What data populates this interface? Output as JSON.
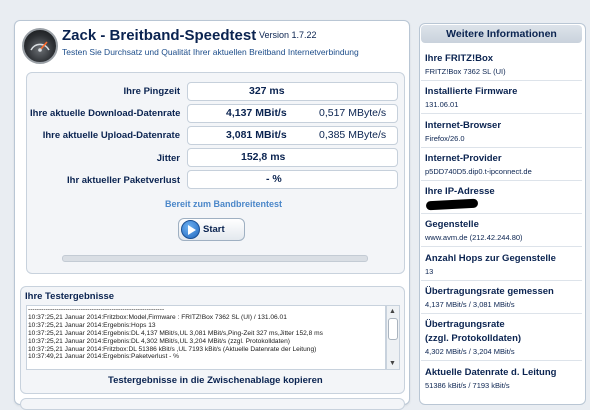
{
  "app": {
    "title": "Zack - Breitband-Speedtest",
    "version": "Version 1.7.22",
    "subtitle": "Testen Sie Durchsatz und Qualität Ihrer aktuellen Breitband Internetverbindung"
  },
  "metrics": {
    "ping": {
      "label": "Ihre Pingzeit",
      "value": "327 ms"
    },
    "download": {
      "label": "Ihre aktuelle Download-Datenrate",
      "value": "4,137 MBit/s",
      "secondary": "0,517 MByte/s"
    },
    "upload": {
      "label": "Ihre aktuelle Upload-Datenrate",
      "value": "3,081 MBit/s",
      "secondary": "0,385 MByte/s"
    },
    "jitter": {
      "label": "Jitter",
      "value": "152,8 ms"
    },
    "loss": {
      "label": "Ihr aktueller Paketverlust",
      "value": "-  %"
    }
  },
  "status": "Bereit zum Bandbreitentest",
  "start_button": {
    "label": "Start"
  },
  "results": {
    "title": "Ihre Testergebnisse",
    "log": [
      "--------------------------------------------------------------",
      "10:37:25,21 Januar 2014:Fritzbox:Model,Firmware : FRITZ!Box 7362 SL (UI) / 131.06.01",
      "10:37:25,21 Januar 2014:Ergebnis:Hops 13",
      "10:37:25,21 Januar 2014:Ergebnis:DL 4,137 MBit/s,UL 3,081 MBit/s,Ping-Zeit 327 ms,Jitter 152,8 ms",
      "10:37:25,21 Januar 2014:Ergebnis:DL 4,302 MBit/s,UL 3,204 MBit/s (zzgl. Protokolldaten)",
      "10:37:25,21 Januar 2014:Fritzbox:DL 51386 kBit/s ,UL 7193 kBit/s (Aktuelle Datenrate der Leitung)",
      "10:37:49,21 Januar 2014:Ergebnis:Paketverlust -  %"
    ],
    "copy_label": "Testergebnisse in die Zwischenablage kopieren"
  },
  "sidebar": {
    "title": "Weitere Informationen",
    "items": [
      {
        "heading": "Ihre FRITZ!Box",
        "value": "FRITZ!Box 7362 SL (UI)"
      },
      {
        "heading": "Installierte Firmware",
        "value": "131.06.01"
      },
      {
        "heading": "Internet-Browser",
        "value": "Firefox/26.0"
      },
      {
        "heading": "Internet-Provider",
        "value": "p5DD740D5.dip0.t-ipconnect.de"
      },
      {
        "heading": "Ihre IP-Adresse",
        "value": ""
      },
      {
        "heading": "Gegenstelle",
        "value": "www.avm.de (212.42.244.80)"
      },
      {
        "heading": "Anzahl Hops zur Gegenstelle",
        "value": "13"
      },
      {
        "heading": "Übertragungsrate gemessen",
        "value": "4,137 MBit/s / 3,081 MBit/s"
      },
      {
        "heading": "Übertragungsrate",
        "heading2": "(zzgl. Protokolldaten)",
        "value": "4,302 MBit/s / 3,204 MBit/s"
      },
      {
        "heading": "Aktuelle Datenrate d. Leitung",
        "value": "51386 kBit/s / 7193 kBit/s"
      }
    ]
  },
  "icons": {
    "logo": "speedometer-icon",
    "start": "play-icon"
  },
  "colors": {
    "accent": "#4b87c9",
    "text": "#0a2350"
  }
}
